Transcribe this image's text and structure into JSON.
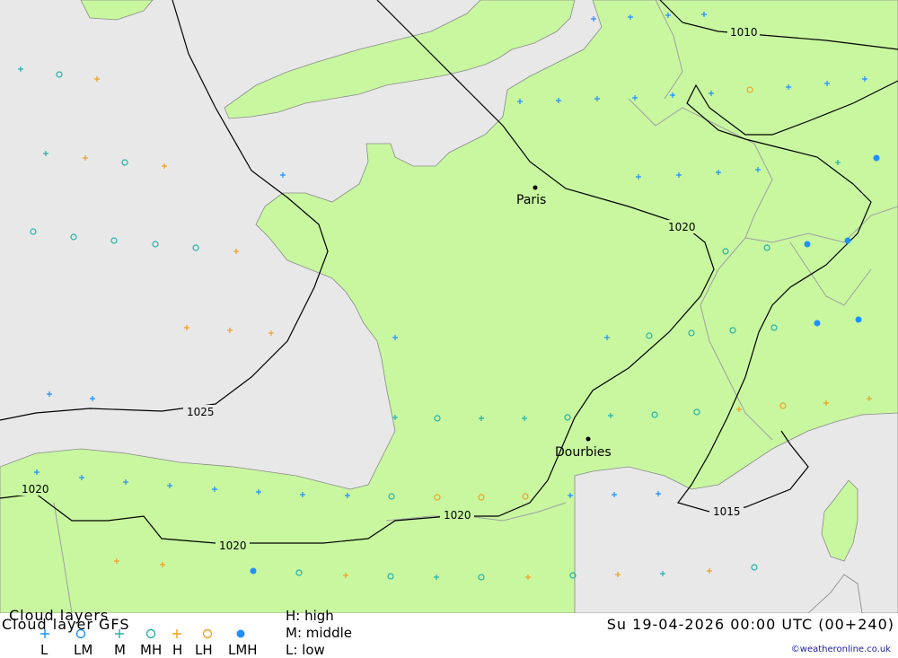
{
  "title": "Cloud layers",
  "subtitle": "Cloud layer GFS",
  "datetime": "Su 19-04-2026 00:00 UTC (00+240)",
  "credit": "©weatheronline.co.uk",
  "key": {
    "high": "H: high",
    "middle": "M: middle",
    "low": "L: low"
  },
  "legend": {
    "labels": [
      "L",
      "LM",
      "M",
      "MH",
      "H",
      "LH",
      "LMH"
    ],
    "symbols": [
      "plus",
      "circle",
      "plus",
      "circle",
      "plus",
      "circle",
      "dot"
    ],
    "colors": [
      "#1e90ff",
      "#1e90ff",
      "#20b2aa",
      "#20b2aa",
      "#f0a020",
      "#f0a020",
      "#1e90ff"
    ]
  },
  "map": {
    "cities": [
      "Paris",
      "Dourbies"
    ],
    "isobar_labels": [
      "1010",
      "1020",
      "1025",
      "1020",
      "1020",
      "1020",
      "1015"
    ],
    "colors": {
      "sea": "#e8e8e8",
      "land": "#c8f7a0",
      "borders": "#a0a0a0",
      "isobars": "#000000"
    }
  }
}
